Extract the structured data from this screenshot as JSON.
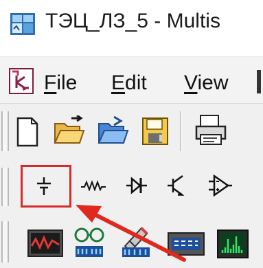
{
  "window": {
    "title": "ТЭЦ_ЛЗ_5 - Multis",
    "app_icon": "multisim-app-icon"
  },
  "menu": {
    "items": [
      {
        "label": "File",
        "underline": "F",
        "rest": "ile"
      },
      {
        "label": "Edit",
        "underline": "E",
        "rest": "dit"
      },
      {
        "label": "View",
        "underline": "V",
        "rest": "iew"
      }
    ]
  },
  "toolbar_standard": {
    "icons": [
      "new-file-icon",
      "open-folder-icon",
      "open-sample-icon",
      "save-icon",
      "print-icon"
    ]
  },
  "toolbar_components": {
    "icons": [
      "source-component-icon",
      "basic-component-icon",
      "diode-component-icon",
      "transistor-component-icon",
      "analog-component-icon"
    ],
    "highlighted": "source-component-icon"
  },
  "toolbar_instruments": {
    "icons": [
      "oscilloscope-icon",
      "logic-analyzer-icon",
      "probe-icon",
      "multimeter-icon",
      "spectrum-analyzer-icon"
    ]
  },
  "colors": {
    "highlight": "#d72a2a",
    "arrow": "#e0281f"
  }
}
